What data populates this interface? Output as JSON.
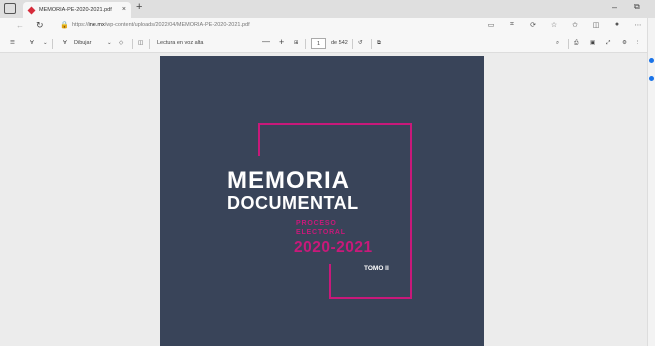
{
  "tab": {
    "title": "MEMORIA-PE-2020-2021.pdf",
    "close": "×",
    "new": "+"
  },
  "window": {
    "minimize": "–",
    "restore": "⧉"
  },
  "address": {
    "prefix": "https://",
    "domain": "ine.mx",
    "path": "/wp-content/uploads/2022/04/MEMORIA-PE-2020-2021.pdf"
  },
  "toolbar": {
    "draw_label": "Dibujar",
    "read_aloud_label": "Lectura en voz alta",
    "zoom_out": "—",
    "zoom_in": "+",
    "current_page": "1",
    "page_total": "de 542"
  },
  "document": {
    "title_line1": "MEMORIA",
    "title_line2": "DOCUMENTAL",
    "subtitle_line1": "PROCESO",
    "subtitle_line2": "ELECTORAL",
    "years": "2020-2021",
    "volume": "TOMO II"
  },
  "colors": {
    "cover_bg": "#394459",
    "accent": "#c8197a"
  }
}
